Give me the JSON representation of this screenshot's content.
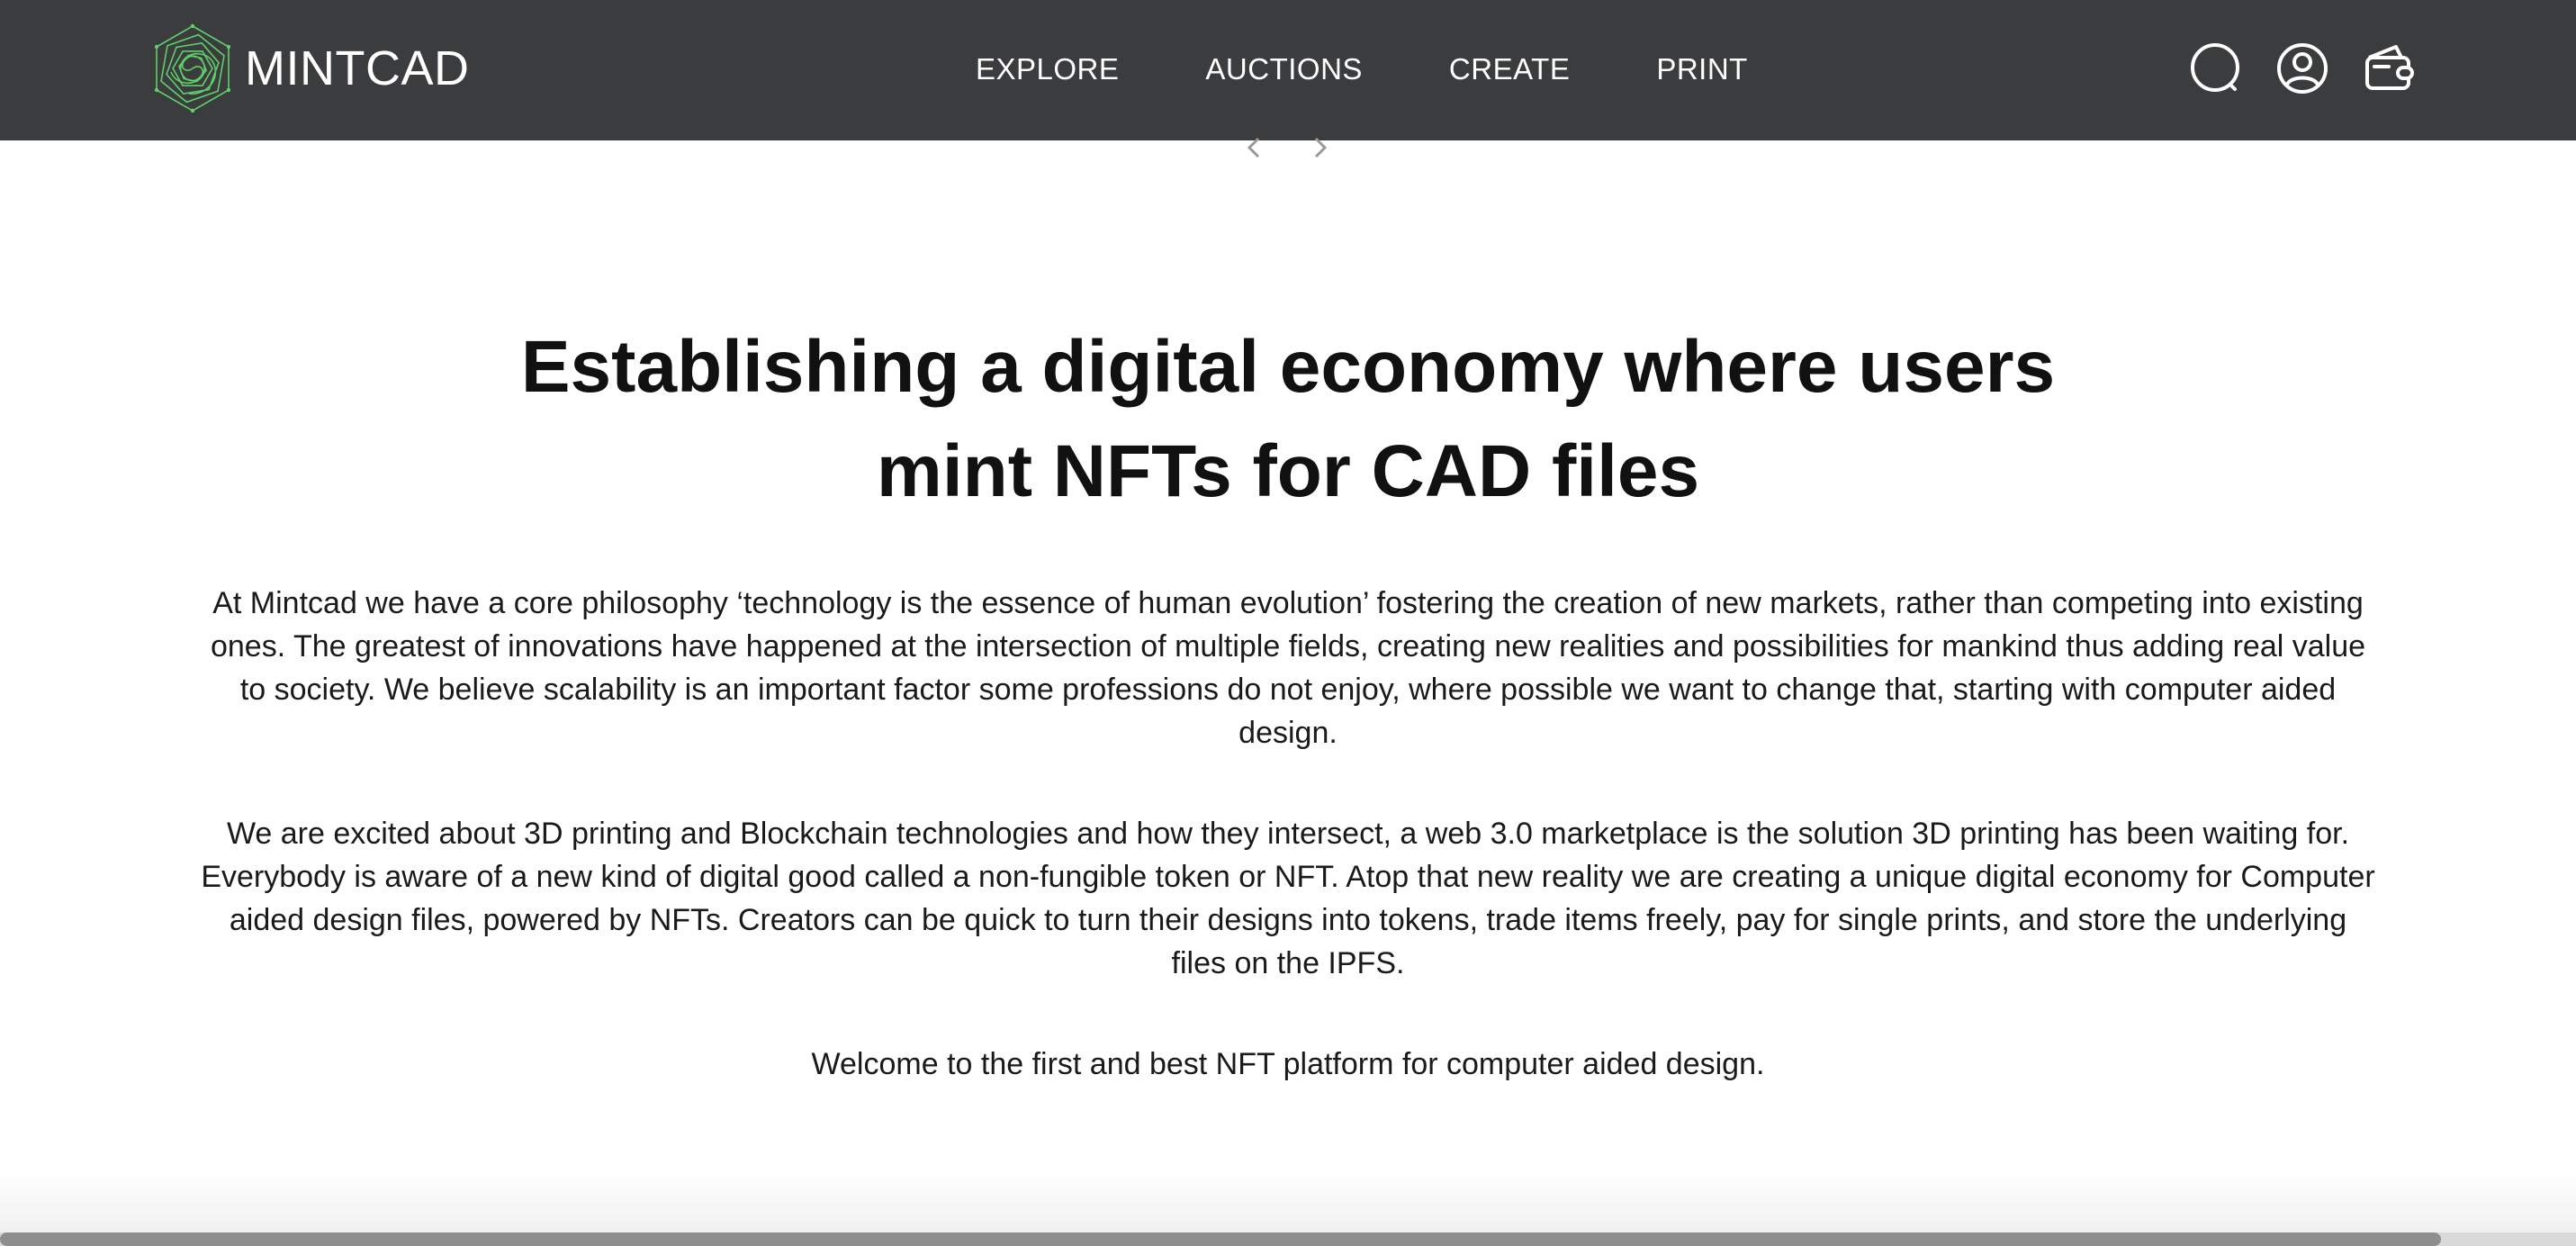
{
  "brand": {
    "name": "MINTCAD",
    "logo_icon": "hexagon-spiral-logo-icon",
    "logo_color": "#5fcf6a"
  },
  "nav": {
    "links": [
      "EXPLORE",
      "AUCTIONS",
      "CREATE",
      "PRINT"
    ],
    "icons": [
      "search-icon",
      "account-icon",
      "wallet-icon"
    ]
  },
  "carousel": {
    "prev_icon": "chevron-left-icon",
    "next_icon": "chevron-right-icon"
  },
  "about": {
    "headline_line1": "Establishing a digital economy where users",
    "headline_line2": "mint NFTs for CAD files",
    "paragraphs": [
      "At Mintcad we have a core philosophy ‘technology is the essence of human evolution’ fostering the creation of new markets, rather than competing into existing ones. The greatest of innovations have happened at the intersection of multiple fields, creating new realities and possibilities for mankind thus adding real value to society. We believe scalability is an important factor some professions do not enjoy, where possible we want to change that, starting with computer aided design.",
      "We are excited about 3D printing and Blockchain technologies and how they intersect, a web 3.0 marketplace is the solution 3D printing has been waiting for. Everybody is aware of a new kind of digital good called a non-fungible token or NFT. Atop that new reality we are creating a unique digital economy for Computer aided design files, powered by NFTs. Creators can be quick to turn their designs into tokens, trade items freely, pay for single prints, and store the underlying files on the IPFS.",
      "Welcome to the first and best NFT platform for computer aided design."
    ]
  },
  "colors": {
    "navbar_bg": "#3b3c3e",
    "nav_text": "#ffffff",
    "body_text": "#111111",
    "scrollbar_thumb": "#8e8e8e",
    "scrollbar_track": "#d9d9d9"
  }
}
